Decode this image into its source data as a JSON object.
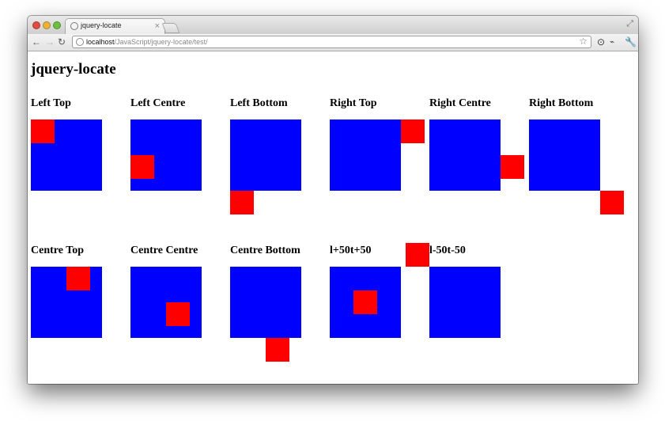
{
  "browser": {
    "tab_title": "jquery-locate",
    "tab_close": "×",
    "url_host": "localhost",
    "url_path": "/JavaScript/jquery-locate/test/"
  },
  "page": {
    "title": "jquery-locate",
    "cells": [
      {
        "label": "Left Top"
      },
      {
        "label": "Left Centre"
      },
      {
        "label": "Left Bottom"
      },
      {
        "label": "Right Top"
      },
      {
        "label": "Right Centre"
      },
      {
        "label": "Right Bottom"
      },
      {
        "label": "Centre Top"
      },
      {
        "label": "Centre Centre"
      },
      {
        "label": "Centre Bottom"
      },
      {
        "label": "l+50t+50"
      },
      {
        "label": "l-50t-50"
      }
    ]
  },
  "colors": {
    "target_box": "#0000ff",
    "located_box": "#ff0000"
  },
  "icons": [
    "back-arrow-icon",
    "forward-arrow-icon",
    "reload-icon",
    "globe-icon",
    "star-icon",
    "wrench-icon",
    "fullscreen-icon",
    "close-icon"
  ]
}
